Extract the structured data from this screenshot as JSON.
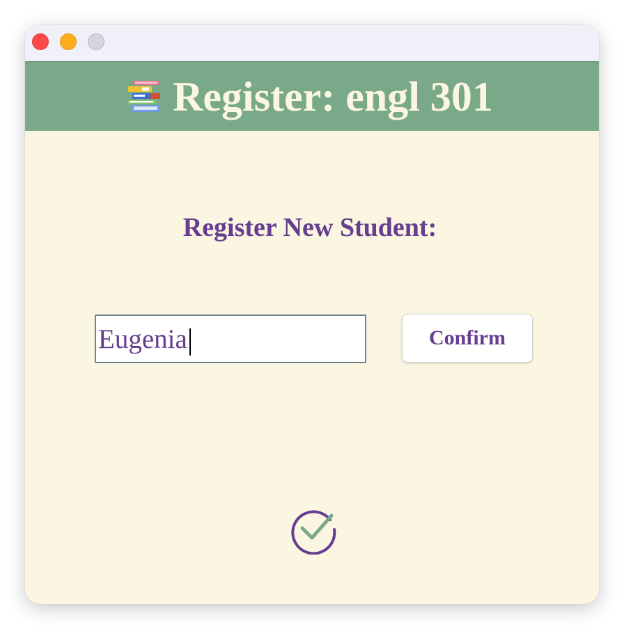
{
  "window": {
    "title": "",
    "controls": {
      "close": "close",
      "minimize": "minimize",
      "zoom": "zoom"
    }
  },
  "header": {
    "icon": "books-icon",
    "title": "Register: engl 301"
  },
  "form": {
    "heading": "Register New Student:",
    "name_input": {
      "value": "Eugenia",
      "placeholder": ""
    },
    "confirm_label": "Confirm"
  },
  "status": {
    "icon": "check-circle-icon"
  },
  "colors": {
    "header_bg": "#7aa98a",
    "window_bg": "#fbf6e1",
    "accent_purple": "#663d8f",
    "check_green": "#7aa98a"
  }
}
